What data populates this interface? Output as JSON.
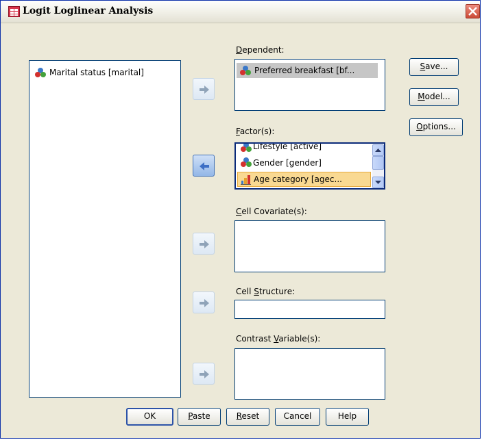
{
  "window": {
    "title": "Logit Loglinear Analysis"
  },
  "source_list": {
    "items": [
      {
        "label": "Marital status [marital]",
        "icon": "nominal-icon"
      }
    ]
  },
  "dependent": {
    "label_pre": "",
    "label_key": "D",
    "label_post": "ependent:",
    "items": [
      {
        "label": "Preferred breakfast [bf...",
        "icon": "nominal-icon"
      }
    ]
  },
  "factors": {
    "label_pre": "",
    "label_key": "F",
    "label_post": "actor(s):",
    "items": [
      {
        "label": "Lifestyle [active]",
        "icon": "nominal-icon"
      },
      {
        "label": "Gender [gender]",
        "icon": "nominal-icon"
      },
      {
        "label": "Age category [agec...",
        "icon": "ordinal-icon"
      }
    ]
  },
  "cell_covariates": {
    "label_pre": "",
    "label_key": "C",
    "label_post": "ell Covariate(s):"
  },
  "cell_structure": {
    "label_pre": "Cell ",
    "label_key": "S",
    "label_post": "tructure:"
  },
  "contrast": {
    "label_pre": "Contrast ",
    "label_key": "V",
    "label_post": "ariable(s):"
  },
  "side_buttons": {
    "save": {
      "key": "S",
      "rest": "ave..."
    },
    "model": {
      "key": "M",
      "rest": "odel..."
    },
    "options": {
      "key": "O",
      "rest": "ptions..."
    }
  },
  "bottom_buttons": {
    "ok": {
      "pre": "OK",
      "key": "",
      "rest": ""
    },
    "paste": {
      "pre": "",
      "key": "P",
      "rest": "aste"
    },
    "reset": {
      "pre": "",
      "key": "R",
      "rest": "eset"
    },
    "cancel": {
      "pre": "Cancel",
      "key": "",
      "rest": ""
    },
    "help": {
      "pre": "Help",
      "key": "",
      "rest": ""
    }
  },
  "colors": {
    "selection": "#f9d992",
    "accent": "#003c74"
  }
}
